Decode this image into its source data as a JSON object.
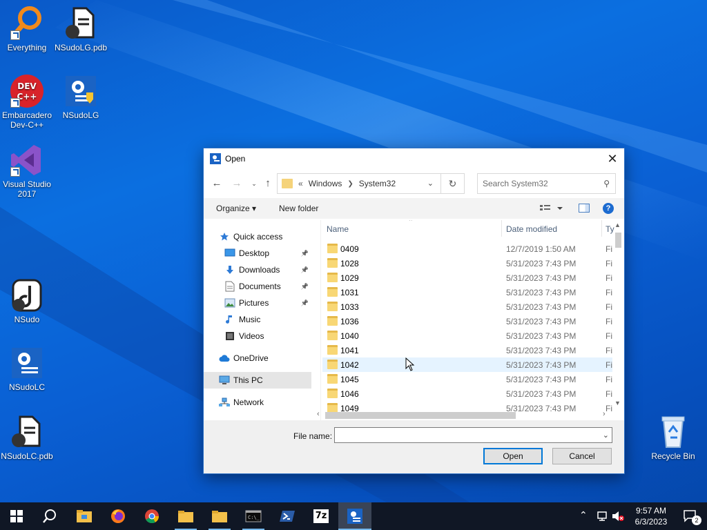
{
  "desktop": {
    "icons": [
      {
        "label": "Everything",
        "icon": "everything-icon"
      },
      {
        "label": "NSudoLG.pdb",
        "icon": "pdb-file-icon"
      },
      {
        "label": "Embarcadero Dev-C++",
        "icon": "devcpp-icon"
      },
      {
        "label": "NSudoLG",
        "icon": "nsudo-config-icon"
      },
      {
        "label": "Visual Studio 2017",
        "icon": "visual-studio-icon"
      },
      {
        "label": "NSudo",
        "icon": "nsudo-icon"
      },
      {
        "label": "NSudoLC",
        "icon": "nsudo-config-icon"
      },
      {
        "label": "NSudoLC.pdb",
        "icon": "pdb-file-icon"
      },
      {
        "label": "Recycle Bin",
        "icon": "recycle-bin-icon"
      }
    ]
  },
  "dialog": {
    "title": "Open",
    "address": {
      "overflow": "«",
      "crumbs": [
        "Windows",
        "System32"
      ]
    },
    "search_placeholder": "Search System32",
    "toolbar": {
      "organize": "Organize ▾",
      "new_folder": "New folder"
    },
    "nav": {
      "items": [
        {
          "label": "Quick access",
          "icon": "star-icon",
          "pinned": false
        },
        {
          "label": "Desktop",
          "icon": "desktop-icon",
          "pinned": true
        },
        {
          "label": "Downloads",
          "icon": "download-icon",
          "pinned": true
        },
        {
          "label": "Documents",
          "icon": "documents-icon",
          "pinned": true
        },
        {
          "label": "Pictures",
          "icon": "pictures-icon",
          "pinned": true
        },
        {
          "label": "Music",
          "icon": "music-icon",
          "pinned": false
        },
        {
          "label": "Videos",
          "icon": "videos-icon",
          "pinned": false
        },
        {
          "label": "OneDrive",
          "icon": "cloud-icon",
          "pinned": false
        },
        {
          "label": "This PC",
          "icon": "computer-icon",
          "pinned": false,
          "selected": true
        },
        {
          "label": "Network",
          "icon": "network-icon",
          "pinned": false
        }
      ]
    },
    "columns": {
      "name": "Name",
      "date": "Date modified",
      "type": "Ty"
    },
    "files": [
      {
        "name": "0409",
        "date": "12/7/2019 1:50 AM",
        "type": "Fi"
      },
      {
        "name": "1028",
        "date": "5/31/2023 7:43 PM",
        "type": "Fi"
      },
      {
        "name": "1029",
        "date": "5/31/2023 7:43 PM",
        "type": "Fi"
      },
      {
        "name": "1031",
        "date": "5/31/2023 7:43 PM",
        "type": "Fi"
      },
      {
        "name": "1033",
        "date": "5/31/2023 7:43 PM",
        "type": "Fi"
      },
      {
        "name": "1036",
        "date": "5/31/2023 7:43 PM",
        "type": "Fi"
      },
      {
        "name": "1040",
        "date": "5/31/2023 7:43 PM",
        "type": "Fi"
      },
      {
        "name": "1041",
        "date": "5/31/2023 7:43 PM",
        "type": "Fi"
      },
      {
        "name": "1042",
        "date": "5/31/2023 7:43 PM",
        "type": "Fi",
        "hover": true
      },
      {
        "name": "1045",
        "date": "5/31/2023 7:43 PM",
        "type": "Fi"
      },
      {
        "name": "1046",
        "date": "5/31/2023 7:43 PM",
        "type": "Fi"
      },
      {
        "name": "1049",
        "date": "5/31/2023 7:43 PM",
        "type": "Fi"
      }
    ],
    "file_name_label": "File name:",
    "file_name_value": "",
    "open_label": "Open",
    "cancel_label": "Cancel"
  },
  "taskbar": {
    "apps": [
      "start-icon",
      "search-icon",
      "file-explorer-icon",
      "firefox-icon",
      "chrome-icon",
      "folder-icon",
      "folder-icon",
      "terminal-icon",
      "powershell-icon",
      "7zip-icon",
      "nsudo-config-icon"
    ],
    "sevenzip_label": "7z",
    "time": "9:57 AM",
    "date": "6/3/2023",
    "notification_count": "2"
  },
  "colors": {
    "accent": "#0078d7",
    "folder": "#f8d775",
    "taskbar": "#101725"
  }
}
